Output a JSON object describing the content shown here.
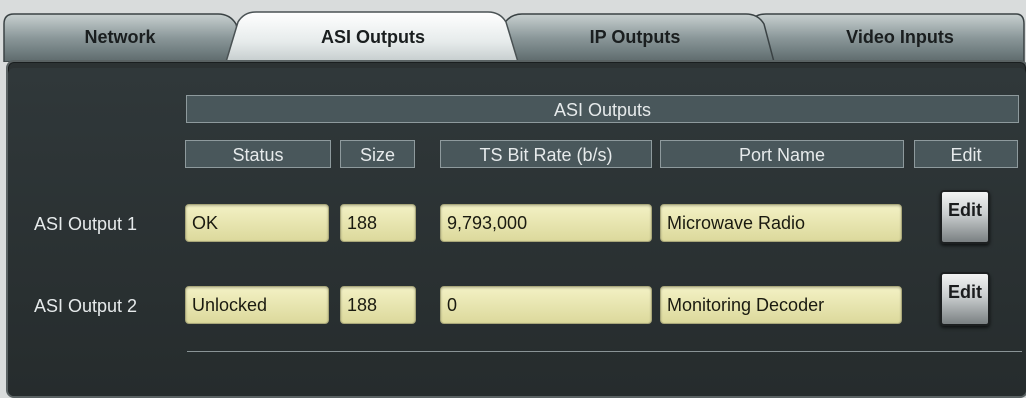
{
  "tabs": [
    {
      "label": "Network",
      "active": false
    },
    {
      "label": "ASI Outputs",
      "active": true
    },
    {
      "label": "IP Outputs",
      "active": false
    },
    {
      "label": "Video Inputs",
      "active": false
    }
  ],
  "table": {
    "title": "ASI Outputs",
    "columns": [
      "Status",
      "Size",
      "TS Bit Rate (b/s)",
      "Port Name",
      "Edit"
    ],
    "rows": [
      {
        "label": "ASI Output 1",
        "status": "OK",
        "size": "188",
        "bitrate": "9,793,000",
        "port_name": "Microwave Radio",
        "edit": "Edit"
      },
      {
        "label": "ASI Output 2",
        "status": "Unlocked",
        "size": "188",
        "bitrate": "0",
        "port_name": "Monitoring Decoder",
        "edit": "Edit"
      }
    ]
  }
}
